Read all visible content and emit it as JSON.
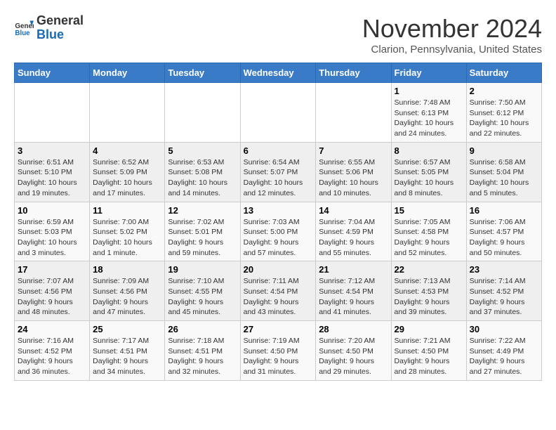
{
  "header": {
    "logo_general": "General",
    "logo_blue": "Blue",
    "month_title": "November 2024",
    "location": "Clarion, Pennsylvania, United States"
  },
  "days_of_week": [
    "Sunday",
    "Monday",
    "Tuesday",
    "Wednesday",
    "Thursday",
    "Friday",
    "Saturday"
  ],
  "weeks": [
    [
      {
        "day": "",
        "info": ""
      },
      {
        "day": "",
        "info": ""
      },
      {
        "day": "",
        "info": ""
      },
      {
        "day": "",
        "info": ""
      },
      {
        "day": "",
        "info": ""
      },
      {
        "day": "1",
        "info": "Sunrise: 7:48 AM\nSunset: 6:13 PM\nDaylight: 10 hours and 24 minutes."
      },
      {
        "day": "2",
        "info": "Sunrise: 7:50 AM\nSunset: 6:12 PM\nDaylight: 10 hours and 22 minutes."
      }
    ],
    [
      {
        "day": "3",
        "info": "Sunrise: 6:51 AM\nSunset: 5:10 PM\nDaylight: 10 hours and 19 minutes."
      },
      {
        "day": "4",
        "info": "Sunrise: 6:52 AM\nSunset: 5:09 PM\nDaylight: 10 hours and 17 minutes."
      },
      {
        "day": "5",
        "info": "Sunrise: 6:53 AM\nSunset: 5:08 PM\nDaylight: 10 hours and 14 minutes."
      },
      {
        "day": "6",
        "info": "Sunrise: 6:54 AM\nSunset: 5:07 PM\nDaylight: 10 hours and 12 minutes."
      },
      {
        "day": "7",
        "info": "Sunrise: 6:55 AM\nSunset: 5:06 PM\nDaylight: 10 hours and 10 minutes."
      },
      {
        "day": "8",
        "info": "Sunrise: 6:57 AM\nSunset: 5:05 PM\nDaylight: 10 hours and 8 minutes."
      },
      {
        "day": "9",
        "info": "Sunrise: 6:58 AM\nSunset: 5:04 PM\nDaylight: 10 hours and 5 minutes."
      }
    ],
    [
      {
        "day": "10",
        "info": "Sunrise: 6:59 AM\nSunset: 5:03 PM\nDaylight: 10 hours and 3 minutes."
      },
      {
        "day": "11",
        "info": "Sunrise: 7:00 AM\nSunset: 5:02 PM\nDaylight: 10 hours and 1 minute."
      },
      {
        "day": "12",
        "info": "Sunrise: 7:02 AM\nSunset: 5:01 PM\nDaylight: 9 hours and 59 minutes."
      },
      {
        "day": "13",
        "info": "Sunrise: 7:03 AM\nSunset: 5:00 PM\nDaylight: 9 hours and 57 minutes."
      },
      {
        "day": "14",
        "info": "Sunrise: 7:04 AM\nSunset: 4:59 PM\nDaylight: 9 hours and 55 minutes."
      },
      {
        "day": "15",
        "info": "Sunrise: 7:05 AM\nSunset: 4:58 PM\nDaylight: 9 hours and 52 minutes."
      },
      {
        "day": "16",
        "info": "Sunrise: 7:06 AM\nSunset: 4:57 PM\nDaylight: 9 hours and 50 minutes."
      }
    ],
    [
      {
        "day": "17",
        "info": "Sunrise: 7:07 AM\nSunset: 4:56 PM\nDaylight: 9 hours and 48 minutes."
      },
      {
        "day": "18",
        "info": "Sunrise: 7:09 AM\nSunset: 4:56 PM\nDaylight: 9 hours and 47 minutes."
      },
      {
        "day": "19",
        "info": "Sunrise: 7:10 AM\nSunset: 4:55 PM\nDaylight: 9 hours and 45 minutes."
      },
      {
        "day": "20",
        "info": "Sunrise: 7:11 AM\nSunset: 4:54 PM\nDaylight: 9 hours and 43 minutes."
      },
      {
        "day": "21",
        "info": "Sunrise: 7:12 AM\nSunset: 4:54 PM\nDaylight: 9 hours and 41 minutes."
      },
      {
        "day": "22",
        "info": "Sunrise: 7:13 AM\nSunset: 4:53 PM\nDaylight: 9 hours and 39 minutes."
      },
      {
        "day": "23",
        "info": "Sunrise: 7:14 AM\nSunset: 4:52 PM\nDaylight: 9 hours and 37 minutes."
      }
    ],
    [
      {
        "day": "24",
        "info": "Sunrise: 7:16 AM\nSunset: 4:52 PM\nDaylight: 9 hours and 36 minutes."
      },
      {
        "day": "25",
        "info": "Sunrise: 7:17 AM\nSunset: 4:51 PM\nDaylight: 9 hours and 34 minutes."
      },
      {
        "day": "26",
        "info": "Sunrise: 7:18 AM\nSunset: 4:51 PM\nDaylight: 9 hours and 32 minutes."
      },
      {
        "day": "27",
        "info": "Sunrise: 7:19 AM\nSunset: 4:50 PM\nDaylight: 9 hours and 31 minutes."
      },
      {
        "day": "28",
        "info": "Sunrise: 7:20 AM\nSunset: 4:50 PM\nDaylight: 9 hours and 29 minutes."
      },
      {
        "day": "29",
        "info": "Sunrise: 7:21 AM\nSunset: 4:50 PM\nDaylight: 9 hours and 28 minutes."
      },
      {
        "day": "30",
        "info": "Sunrise: 7:22 AM\nSunset: 4:49 PM\nDaylight: 9 hours and 27 minutes."
      }
    ]
  ]
}
